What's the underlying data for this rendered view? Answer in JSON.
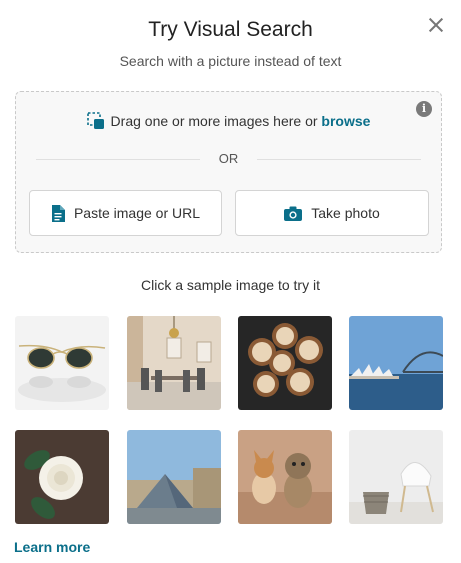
{
  "dialog": {
    "title": "Try Visual Search",
    "subtitle": "Search with a picture instead of text",
    "close_icon": "close-icon"
  },
  "dropzone": {
    "drag_text": "Drag one or more images here or ",
    "browse_link": "browse",
    "or_text": "OR",
    "info_icon": "info-icon",
    "paste_button": "Paste image or URL",
    "photo_button": "Take photo",
    "accent_color": "#0b6f8a"
  },
  "samples": {
    "label": "Click a sample image to try it",
    "images": [
      "sunglasses",
      "dining-room",
      "latte-art-coffees",
      "sydney-opera-house",
      "white-rose",
      "louvre-pyramid",
      "two-dogs",
      "white-chair-and-basket"
    ]
  },
  "footer": {
    "learn_more": "Learn more"
  }
}
